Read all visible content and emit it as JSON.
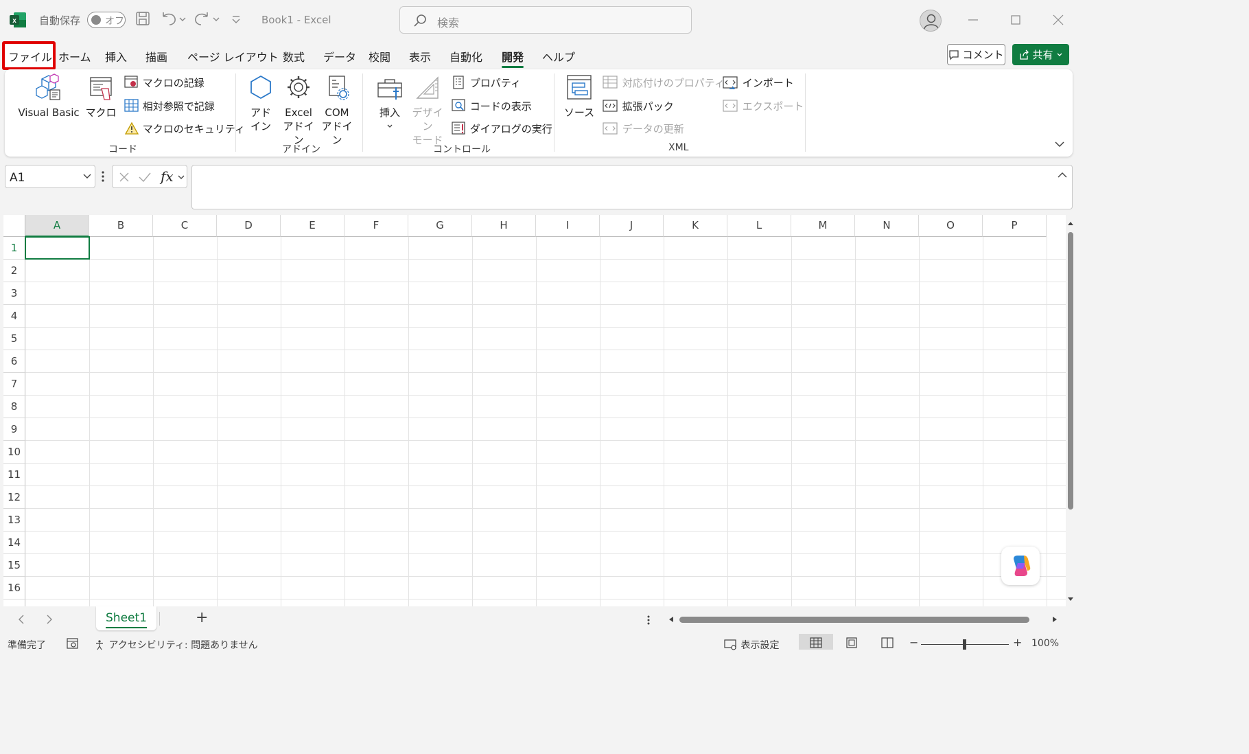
{
  "titlebar": {
    "autosave_label": "自動保存",
    "autosave_state": "オフ",
    "doc_title": "Book1  -  Excel",
    "search_placeholder": "検索"
  },
  "menu": {
    "tabs": [
      "ファイル",
      "ホーム",
      "挿入",
      "描画",
      "ページ レイアウト",
      "数式",
      "データ",
      "校閲",
      "表示",
      "自動化",
      "開発",
      "ヘルプ"
    ],
    "active_tab": "開発",
    "comment_label": "コメント",
    "share_label": "共有"
  },
  "ribbon": {
    "code": {
      "visual_basic": "Visual Basic",
      "macro": "マクロ",
      "record_macro": "マクロの記録",
      "relative_ref": "相対参照で記録",
      "macro_security": "マクロのセキュリティ",
      "group_label": "コード"
    },
    "addins": {
      "addin_line1": "アド",
      "addin_line2": "イン",
      "excel_addin_line1": "Excel",
      "excel_addin_line2": "アドイン",
      "com_addin_line1": "COM",
      "com_addin_line2": "アドイン",
      "group_label": "アドイン"
    },
    "controls": {
      "insert": "挿入",
      "design_mode_line1": "デザイン",
      "design_mode_line2": "モード",
      "properties": "プロパティ",
      "view_code": "コードの表示",
      "run_dialog": "ダイアログの実行",
      "group_label": "コントロール"
    },
    "xml": {
      "source": "ソース",
      "map_properties": "対応付けのプロパティ",
      "expansion_packs": "拡張パック",
      "refresh_data": "データの更新",
      "import": "インポート",
      "export": "エクスポート",
      "group_label": "XML"
    }
  },
  "formula_bar": {
    "name_box": "A1",
    "fx": "fx"
  },
  "grid": {
    "columns": [
      "A",
      "B",
      "C",
      "D",
      "E",
      "F",
      "G",
      "H",
      "I",
      "J",
      "K",
      "L",
      "M",
      "N",
      "O",
      "P"
    ],
    "rows": [
      "1",
      "2",
      "3",
      "4",
      "5",
      "6",
      "7",
      "8",
      "9",
      "10",
      "11",
      "12",
      "13",
      "14",
      "15",
      "16"
    ]
  },
  "sheets": {
    "tabs": [
      "Sheet1"
    ],
    "add_label": "+"
  },
  "statusbar": {
    "ready": "準備完了",
    "accessibility": "アクセシビリティ: 問題ありません",
    "display_settings": "表示設定",
    "zoom_minus": "−",
    "zoom_plus": "+",
    "zoom": "100%"
  },
  "colors": {
    "accent": "#107c41",
    "highlight_box": "#e00000",
    "disabled_text": "#a6a6a6"
  }
}
